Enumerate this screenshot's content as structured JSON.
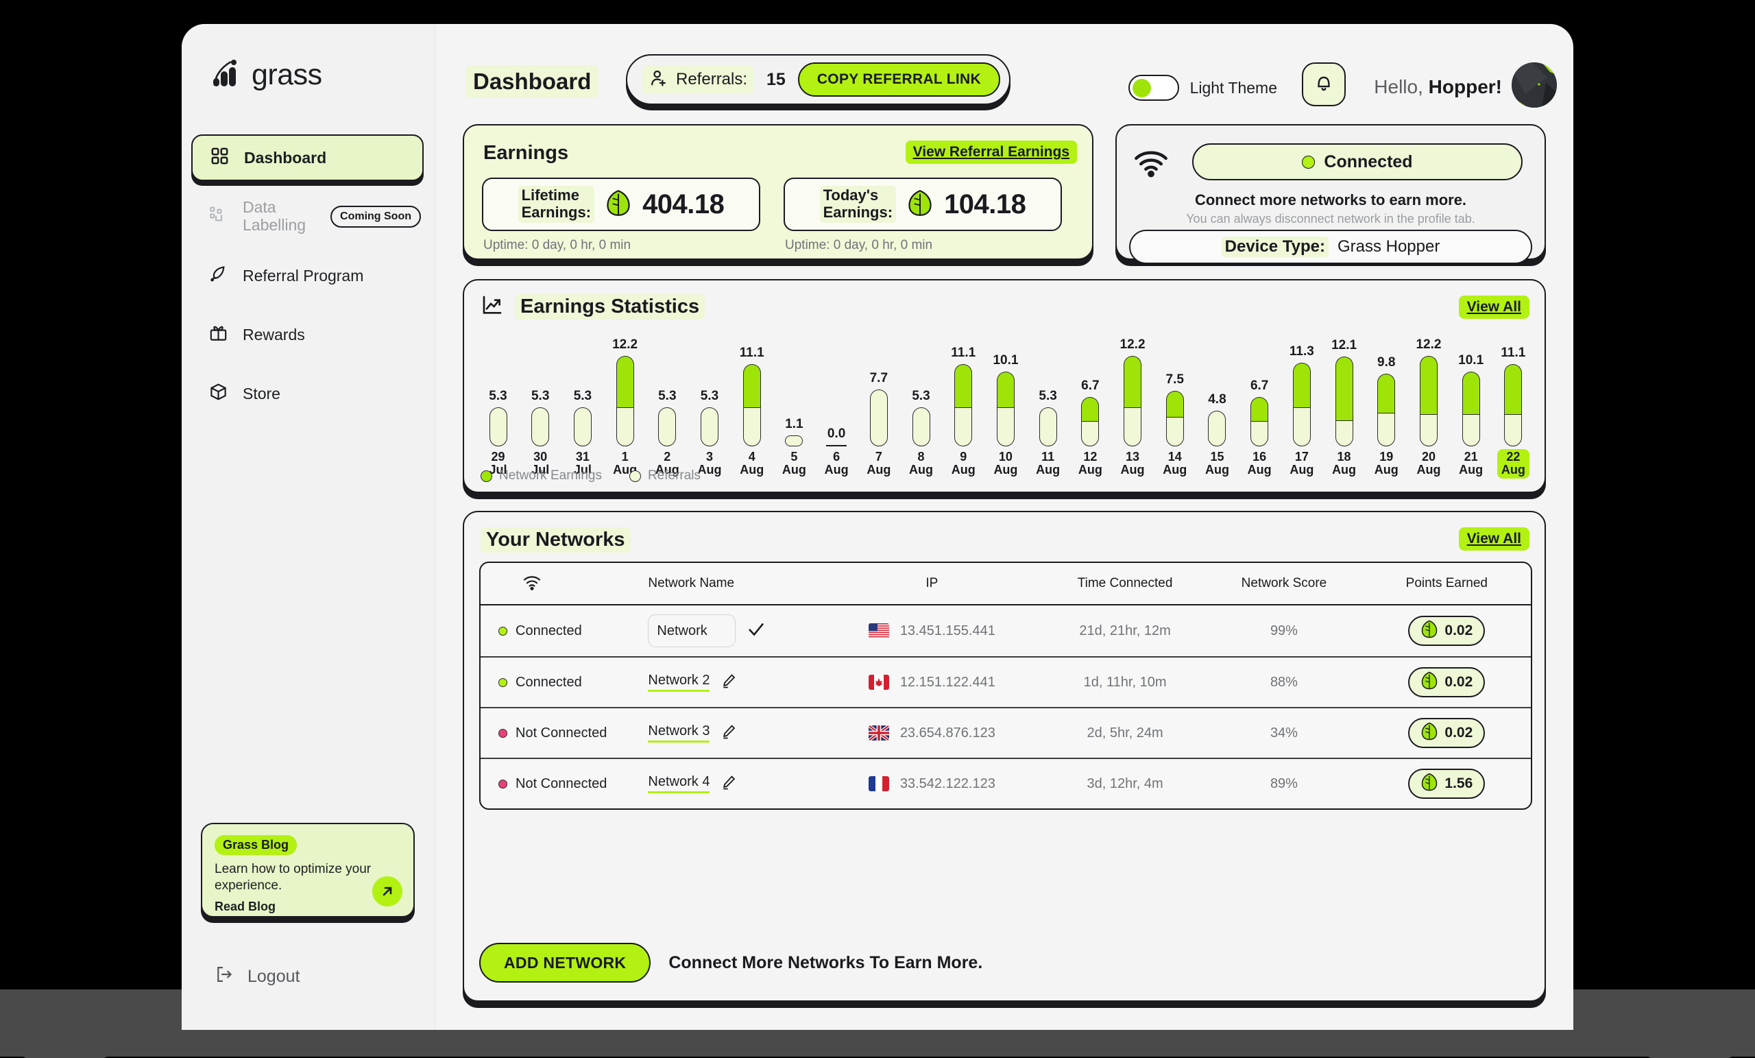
{
  "brand": {
    "name": "grass",
    "logo_icon": "grass-logo-icon"
  },
  "sidebar": {
    "items": [
      {
        "label": "Dashboard",
        "icon": "grid-icon",
        "active": true
      },
      {
        "label": "Data Labelling",
        "icon": "data-nodes-icon",
        "badge": "Coming Soon",
        "disabled": true
      },
      {
        "label": "Referral Program",
        "icon": "rocket-icon"
      },
      {
        "label": "Rewards",
        "icon": "gift-icon"
      },
      {
        "label": "Store",
        "icon": "box-icon"
      }
    ],
    "blog": {
      "tag": "Grass Blog",
      "description": "Learn how to optimize your experience.",
      "cta": "Read Blog",
      "arrow_icon": "arrow-up-right-icon"
    },
    "logout": {
      "label": "Logout",
      "icon": "logout-icon"
    }
  },
  "header": {
    "page_title": "Dashboard",
    "referrals_icon": "user-plus-icon",
    "referrals_label": "Referrals:",
    "referrals_count": "15",
    "copy_referral_link": "COPY REFERRAL LINK",
    "theme_label": "Light Theme",
    "theme_on": true,
    "bell_icon": "bell-icon",
    "greeting_prefix": "Hello, ",
    "greeting_name": "Hopper!",
    "avatar_icon": "avatar"
  },
  "earnings": {
    "title": "Earnings",
    "view_referral_earnings": "View Referral Earnings",
    "lifetime": {
      "label_line1": "Lifetime",
      "label_line2": "Earnings:",
      "value": "404.18",
      "uptime": "Uptime: 0 day, 0 hr, 0 min"
    },
    "today": {
      "label_line1": "Today's",
      "label_line2": "Earnings:",
      "value": "104.18",
      "uptime": "Uptime: 0 day, 0 hr, 0 min"
    }
  },
  "connection": {
    "wifi_icon": "wifi-icon",
    "status": "Connected",
    "headline": "Connect more networks to earn more.",
    "subtext": "You can always disconnect network in the profile tab.",
    "device_label": "Device Type:",
    "device_value": "Grass Hopper"
  },
  "chart_card": {
    "icon": "trending-up-icon",
    "title": "Earnings Statistics",
    "view_all": "View All"
  },
  "chart_data": {
    "type": "bar",
    "title": "Earnings Statistics",
    "xlabel": "",
    "ylabel": "",
    "ylim": [
      0,
      12.2
    ],
    "grid": false,
    "legend_position": "bottom-left",
    "stacked": true,
    "highlight_category": "22 Aug",
    "categories": [
      "29 Jul",
      "30 Jul",
      "31 Jul",
      "1 Aug",
      "2 Aug",
      "3 Aug",
      "4 Aug",
      "5 Aug",
      "6 Aug",
      "7 Aug",
      "8 Aug",
      "9 Aug",
      "10 Aug",
      "11 Aug",
      "12 Aug",
      "13 Aug",
      "14 Aug",
      "15 Aug",
      "16 Aug",
      "17 Aug",
      "18 Aug",
      "19 Aug",
      "20 Aug",
      "21 Aug",
      "22 Aug"
    ],
    "day_labels": [
      "29",
      "30",
      "31",
      "1",
      "2",
      "3",
      "4",
      "5",
      "6",
      "7",
      "8",
      "9",
      "10",
      "11",
      "12",
      "13",
      "14",
      "15",
      "16",
      "17",
      "18",
      "19",
      "20",
      "21",
      "22"
    ],
    "month_labels": [
      "Jul",
      "Jul",
      "Jul",
      "Aug",
      "Aug",
      "Aug",
      "Aug",
      "Aug",
      "Aug",
      "Aug",
      "Aug",
      "Aug",
      "Aug",
      "Aug",
      "Aug",
      "Aug",
      "Aug",
      "Aug",
      "Aug",
      "Aug",
      "Aug",
      "Aug",
      "Aug",
      "Aug",
      "Aug"
    ],
    "totals": [
      5.3,
      5.3,
      5.3,
      12.2,
      5.3,
      5.3,
      11.1,
      1.1,
      0.0,
      7.7,
      5.3,
      11.1,
      10.1,
      5.3,
      6.7,
      12.2,
      7.5,
      4.8,
      6.7,
      11.3,
      12.1,
      9.8,
      12.2,
      10.1,
      11.1
    ],
    "series": [
      {
        "name": "Referrals",
        "color": "#f0f8d8",
        "values": [
          5.3,
          5.3,
          5.3,
          5.3,
          5.3,
          5.3,
          5.3,
          1.1,
          0.0,
          7.7,
          5.3,
          5.3,
          5.3,
          5.3,
          3.4,
          5.3,
          4.0,
          4.8,
          3.4,
          5.3,
          3.5,
          4.5,
          4.3,
          4.3,
          4.3
        ]
      },
      {
        "name": "Network Earnings",
        "color": "#9ee409",
        "values": [
          0,
          0,
          0,
          6.9,
          0,
          0,
          5.8,
          0,
          0,
          0,
          0,
          5.8,
          4.8,
          0,
          3.3,
          6.9,
          3.5,
          0,
          3.3,
          6.0,
          8.6,
          5.3,
          7.9,
          5.8,
          6.8
        ]
      }
    ],
    "legend": [
      {
        "label": "Network Earnings",
        "color": "#9ee409"
      },
      {
        "label": "Referrals",
        "color": "#f0f8d8"
      }
    ]
  },
  "networks": {
    "title": "Your Networks",
    "view_all": "View All",
    "columns": [
      "",
      "Network Name",
      "IP",
      "Time Connected",
      "Network Score",
      "Points Earned"
    ],
    "wifi_header_icon": "wifi-icon",
    "rows": [
      {
        "status": "Connected",
        "connected": true,
        "name": "Network",
        "editing": true,
        "check_icon": "check-icon",
        "flag": "us",
        "ip": "13.451.155.441",
        "time": "21d, 21hr, 12m",
        "score": "99%",
        "points": "0.02"
      },
      {
        "status": "Connected",
        "connected": true,
        "name": "Network 2",
        "editing": false,
        "edit_icon": "pencil-icon",
        "flag": "ca",
        "ip": "12.151.122.441",
        "time": "1d, 11hr, 10m",
        "score": "88%",
        "points": "0.02"
      },
      {
        "status": "Not Connected",
        "connected": false,
        "name": "Network 3",
        "editing": false,
        "edit_icon": "pencil-icon",
        "flag": "gb",
        "ip": "23.654.876.123",
        "time": "2d, 5hr, 24m",
        "score": "34%",
        "points": "0.02"
      },
      {
        "status": "Not Connected",
        "connected": false,
        "name": "Network 4",
        "editing": false,
        "edit_icon": "pencil-icon",
        "flag": "fr",
        "ip": "33.542.122.123",
        "time": "3d, 12hr, 4m",
        "score": "89%",
        "points": "1.56"
      }
    ],
    "add_button": "ADD NETWORK",
    "add_note": "Connect More Networks To Earn More."
  },
  "colors": {
    "accent": "#b2f112",
    "accent_bar": "#9ee409",
    "pale": "#eef7d6",
    "pale_bar": "#f0f8d8",
    "ink": "#1a1a1f",
    "status_off": "#e8427a"
  }
}
